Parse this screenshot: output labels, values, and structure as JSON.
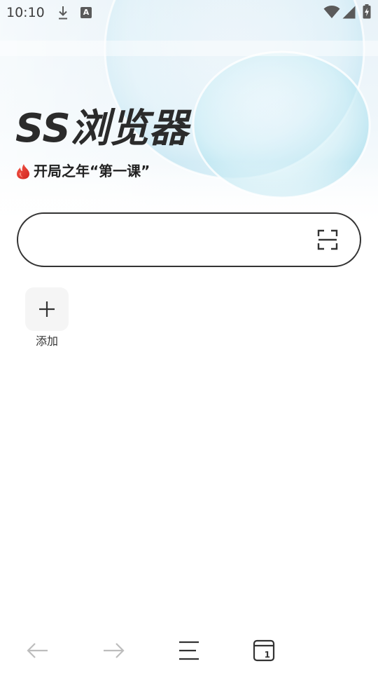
{
  "status_bar": {
    "time": "10:10",
    "notification_icons": [
      "download-icon",
      "text-a-icon"
    ],
    "a_glyph": "A",
    "system_icons": [
      "wifi-icon",
      "cellular-signal-icon",
      "battery-charging-icon"
    ]
  },
  "brand": {
    "title": "SS浏览器",
    "subtitle_icon": "flame-icon",
    "subtitle": "开局之年“第一课”"
  },
  "search": {
    "value": "",
    "placeholder": "",
    "scan_icon": "scan-icon"
  },
  "shortcuts": [
    {
      "label": "添加",
      "icon": "plus-icon"
    }
  ],
  "bottom_nav": {
    "back_icon": "arrow-left-icon",
    "forward_icon": "arrow-right-icon",
    "menu_icon": "menu-icon",
    "tabs_icon": "tabs-icon",
    "tab_count": "1",
    "back_enabled": false,
    "forward_enabled": false
  },
  "colors": {
    "text_primary": "#2b2b2b",
    "search_border": "#333333",
    "disabled_icon": "#bdbdbd",
    "active_icon": "#333333",
    "tile_background": "#f5f5f5",
    "flame": "#e8382f",
    "background_tint": "#e6f2f8"
  }
}
